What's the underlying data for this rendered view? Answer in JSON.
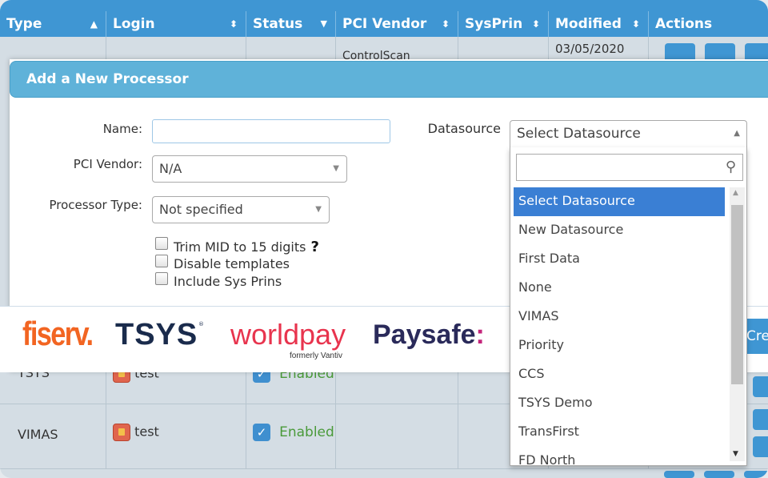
{
  "table": {
    "headers": [
      {
        "label": "Type",
        "icon": "sort-icon"
      },
      {
        "label": "Login",
        "icon": "sort-icon"
      },
      {
        "label": "Status",
        "icon": "caret-down-icon"
      },
      {
        "label": "PCI Vendor",
        "icon": "sort-icon"
      },
      {
        "label": "SysPrin",
        "icon": "sort-icon"
      },
      {
        "label": "Modified",
        "icon": "sort-icon"
      },
      {
        "label": "Actions",
        "icon": ""
      }
    ],
    "partial_row": {
      "pci_vendor": "ControlScan",
      "modified": "03/05/2020"
    },
    "rows": [
      {
        "type": "TSYS",
        "login": "test",
        "status": "Enabled"
      },
      {
        "type": "VIMAS",
        "login": "test",
        "status": "Enabled"
      }
    ]
  },
  "modal": {
    "title": "Add a New Processor",
    "name_label": "Name:",
    "name_value": "",
    "pci_vendor_label": "PCI Vendor:",
    "pci_vendor_value": "N/A",
    "processor_type_label": "Processor Type:",
    "processor_type_value": "Not specified",
    "checkboxes": [
      {
        "label": "Trim MID to 15 digits",
        "checked": false
      },
      {
        "label": "Disable templates",
        "checked": false
      },
      {
        "label": "Include Sys Prins",
        "checked": false
      }
    ],
    "help_mark": "?",
    "datasource_label": "Datasource",
    "create_label": "Cre"
  },
  "logos": {
    "fiserv": "fiserv.",
    "tsys": "TSYS",
    "worldpay": "worldpay",
    "worldpay_sub": "formerly Vantiv",
    "paysafe": "Paysafe:"
  },
  "datasource": {
    "selected": "Select Datasource",
    "search_value": "",
    "options": [
      "Select Datasource",
      "New Datasource",
      "First Data",
      "None",
      "VIMAS",
      "Priority",
      "CCS",
      "TSYS Demo",
      "TransFirst",
      "FD North"
    ],
    "highlighted": "Select Datasource"
  },
  "colors": {
    "header_blue": "#3f96d3",
    "modal_title_blue": "#5fb2d9",
    "highlight_blue": "#3a7fd4",
    "enabled_green": "#4a9a3a",
    "fiserv_orange": "#f26522",
    "tsys_navy": "#1a2b4c",
    "worldpay_red": "#e8344e",
    "paysafe_navy": "#2a2a5a",
    "paysafe_magenta": "#c4257b"
  }
}
